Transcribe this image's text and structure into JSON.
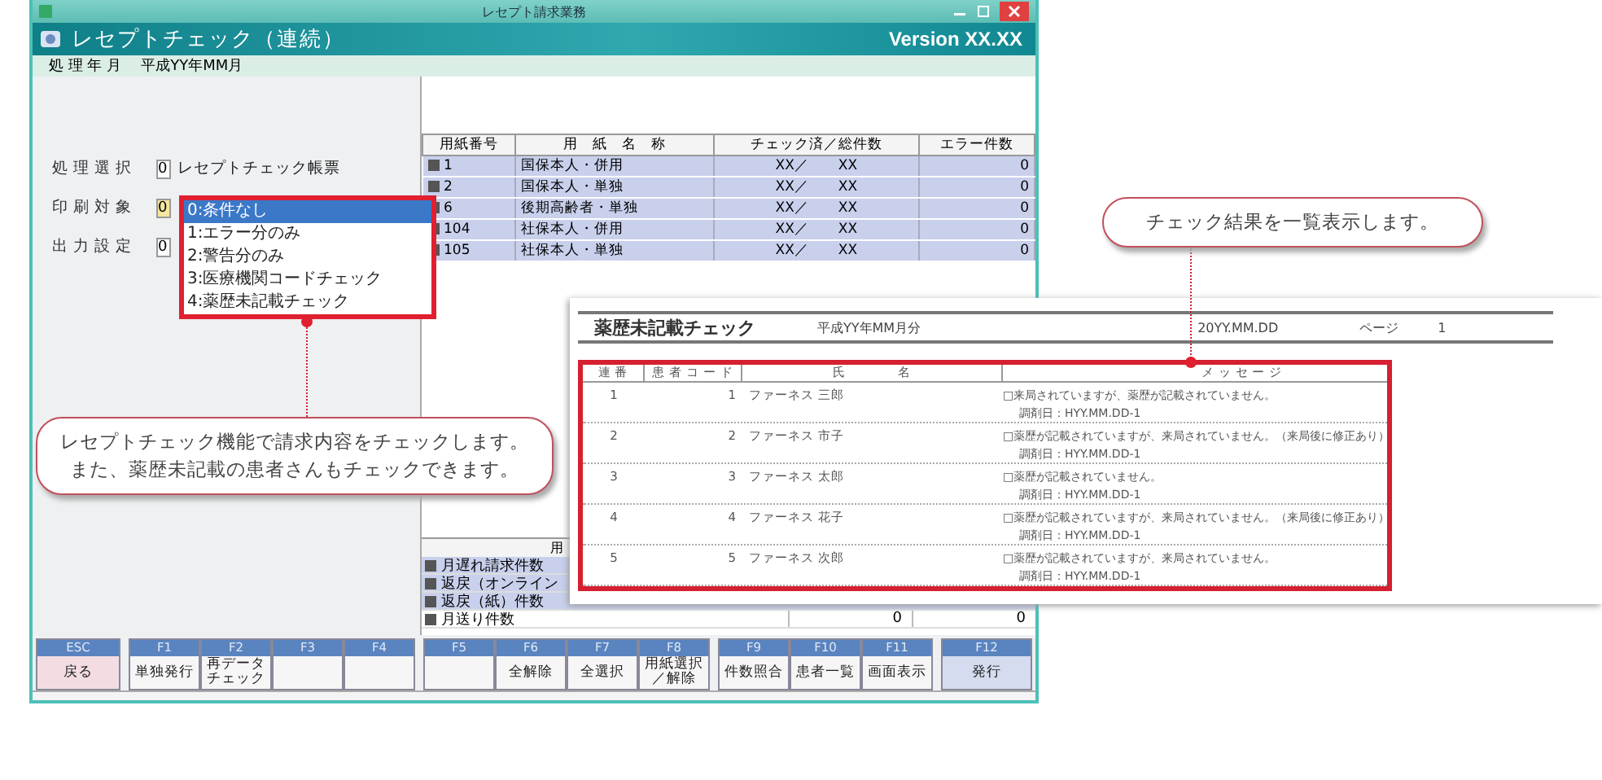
{
  "window": {
    "title": "レセプト請求業務"
  },
  "header": {
    "title": "レセプトチェック（連続）",
    "version": "Version XX.XX"
  },
  "period": {
    "label": "処 理 年 月",
    "value": "平成YY年MM月"
  },
  "form": [
    {
      "label": "処 理 選 択",
      "value": "0",
      "text": "レセプトチェック帳票"
    },
    {
      "label": "印 刷 対 象",
      "value": "0"
    },
    {
      "label": "出 力 設 定",
      "value": "0"
    }
  ],
  "dropdown": {
    "options": [
      {
        "label": "0:条件なし",
        "selected": true
      },
      {
        "label": "1:エラー分のみ",
        "selected": false
      },
      {
        "label": "2:警告分のみ",
        "selected": false
      },
      {
        "label": "3:医療機関コードチェック",
        "selected": false
      },
      {
        "label": "4:薬歴未記載チェック",
        "selected": false
      }
    ]
  },
  "forms_table": {
    "columns": [
      "用紙番号",
      "用　紙　名　称",
      "チェック済／総件数",
      "エラー件数"
    ],
    "rows": [
      {
        "checked": true,
        "number": "1",
        "name": "国保本人・併用",
        "done": "XX／",
        "total": "XX",
        "errors": "0"
      },
      {
        "checked": true,
        "number": "2",
        "name": "国保本人・単独",
        "done": "XX／",
        "total": "XX",
        "errors": "0"
      },
      {
        "checked": true,
        "number": "6",
        "name": "後期高齢者・単独",
        "done": "XX／",
        "total": "XX",
        "errors": "0"
      },
      {
        "checked": true,
        "number": "104",
        "name": "社保本人・併用",
        "done": "XX／",
        "total": "XX",
        "errors": "0"
      },
      {
        "checked": true,
        "number": "105",
        "name": "社保本人・単独",
        "done": "XX／",
        "total": "XX",
        "errors": "0"
      }
    ]
  },
  "counts_table": {
    "header": "用",
    "rows": [
      {
        "checked": true,
        "label": "月遅れ請求件数"
      },
      {
        "checked": true,
        "label": "返戻（オンライン"
      },
      {
        "checked": true,
        "label": "返戻（紙）件数"
      },
      {
        "checked": true,
        "label": "月送り件数",
        "column_2": "0",
        "column_3": "0"
      }
    ]
  },
  "function_keys": [
    [
      {
        "key": "ESC",
        "label": "戻る",
        "kind": "back"
      }
    ],
    [
      {
        "key": "F1",
        "label": "単独発行"
      },
      {
        "key": "F2",
        "label": "再データ",
        "label_2": "チェック"
      },
      {
        "key": "F3"
      },
      {
        "key": "F4"
      }
    ],
    [
      {
        "key": "F5"
      },
      {
        "key": "F6",
        "label": "全解除"
      },
      {
        "key": "F7",
        "label": "全選択"
      },
      {
        "key": "F8",
        "label": "用紙選択",
        "label_2": "／解除"
      }
    ],
    [
      {
        "key": "F9",
        "label": "件数照合"
      },
      {
        "key": "F10",
        "label": "患者一覧"
      },
      {
        "key": "F11",
        "label": "画面表示"
      }
    ],
    [
      {
        "key": "F12",
        "label": "発行",
        "kind": "primary"
      }
    ]
  ],
  "report": {
    "title": "薬歴未記載チェック",
    "period": "平成YY年MM月分",
    "date": "20YY.MM.DD",
    "page_label": "ページ",
    "page": "1",
    "columns": [
      "連 番",
      "患 者 コ ー ド",
      "氏　　　　名",
      "メ ッ セ ー ジ"
    ],
    "rows": [
      {
        "no": "1",
        "code": "1",
        "name": "ファーネス 三郎",
        "message": "□来局されていますが、薬歴が記載されていません。",
        "date": "調剤日：HYY.MM.DD-1"
      },
      {
        "no": "2",
        "code": "2",
        "name": "ファーネス 市子",
        "message": "□薬歴が記載されていますが、来局されていません。（来局後に修正あり）",
        "date": "調剤日：HYY.MM.DD-1"
      },
      {
        "no": "3",
        "code": "3",
        "name": "ファーネス 太郎",
        "message": "□薬歴が記載されていません。",
        "date": "調剤日：HYY.MM.DD-1"
      },
      {
        "no": "4",
        "code": "4",
        "name": "ファーネス 花子",
        "message": "□薬歴が記載されていますが、来局されていません。（来局後に修正あり）",
        "date": "調剤日：HYY.MM.DD-1"
      },
      {
        "no": "5",
        "code": "5",
        "name": "ファーネス 次郎",
        "message": "□薬歴が記載されていますが、来局されていません。",
        "date": "調剤日：HYY.MM.DD-1"
      }
    ]
  },
  "callouts": [
    {
      "lines": [
        "レセプトチェック機能で請求内容をチェックします。",
        "また、薬歴未記載の患者さんもチェックできます。"
      ]
    },
    {
      "lines": [
        "チェック結果を一覧表示します。"
      ]
    }
  ]
}
